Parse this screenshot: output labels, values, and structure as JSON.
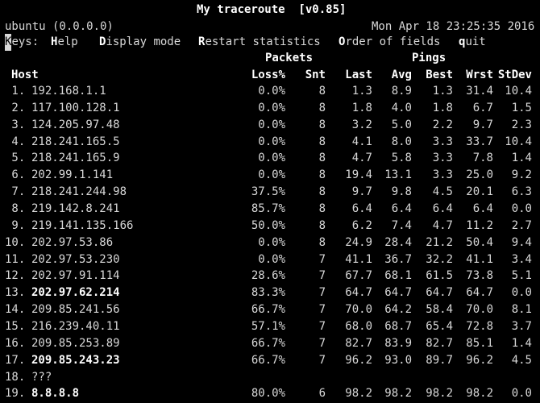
{
  "title": "My traceroute  [v0.85]",
  "hostinfo": "ubuntu (0.0.0.0)",
  "datetime": "Mon Apr 18 23:25:35 2016",
  "keys": {
    "label_first": "K",
    "label_rest": "eys:",
    "items": [
      {
        "key": "H",
        "rest": "elp"
      },
      {
        "key": "D",
        "rest": "isplay mode"
      },
      {
        "key": "R",
        "rest": "estart statistics"
      },
      {
        "key": "O",
        "rest": "rder of fields"
      },
      {
        "key": "q",
        "rest": "uit"
      }
    ]
  },
  "groups": {
    "packets": "Packets",
    "pings": "Pings"
  },
  "columns": {
    "host": "Host",
    "loss": "Loss%",
    "snt": "Snt",
    "last": "Last",
    "avg": "Avg",
    "best": "Best",
    "wrst": "Wrst",
    "stdev": "StDev"
  },
  "rows": [
    {
      "num": " 1.",
      "host": "192.168.1.1",
      "bold": false,
      "loss": "0.0%",
      "snt": "8",
      "last": "1.3",
      "avg": "8.9",
      "best": "1.3",
      "wrst": "31.4",
      "stdev": "10.4"
    },
    {
      "num": " 2.",
      "host": "117.100.128.1",
      "bold": false,
      "loss": "0.0%",
      "snt": "8",
      "last": "1.8",
      "avg": "4.0",
      "best": "1.8",
      "wrst": "6.7",
      "stdev": "1.5"
    },
    {
      "num": " 3.",
      "host": "124.205.97.48",
      "bold": false,
      "loss": "0.0%",
      "snt": "8",
      "last": "3.2",
      "avg": "5.0",
      "best": "2.2",
      "wrst": "9.7",
      "stdev": "2.3"
    },
    {
      "num": " 4.",
      "host": "218.241.165.5",
      "bold": false,
      "loss": "0.0%",
      "snt": "8",
      "last": "4.1",
      "avg": "8.0",
      "best": "3.3",
      "wrst": "33.7",
      "stdev": "10.4"
    },
    {
      "num": " 5.",
      "host": "218.241.165.9",
      "bold": false,
      "loss": "0.0%",
      "snt": "8",
      "last": "4.7",
      "avg": "5.8",
      "best": "3.3",
      "wrst": "7.8",
      "stdev": "1.4"
    },
    {
      "num": " 6.",
      "host": "202.99.1.141",
      "bold": false,
      "loss": "0.0%",
      "snt": "8",
      "last": "19.4",
      "avg": "13.1",
      "best": "3.3",
      "wrst": "25.0",
      "stdev": "9.2"
    },
    {
      "num": " 7.",
      "host": "218.241.244.98",
      "bold": false,
      "loss": "37.5%",
      "snt": "8",
      "last": "9.7",
      "avg": "9.8",
      "best": "4.5",
      "wrst": "20.1",
      "stdev": "6.3"
    },
    {
      "num": " 8.",
      "host": "219.142.8.241",
      "bold": false,
      "loss": "85.7%",
      "snt": "8",
      "last": "6.4",
      "avg": "6.4",
      "best": "6.4",
      "wrst": "6.4",
      "stdev": "0.0"
    },
    {
      "num": " 9.",
      "host": "219.141.135.166",
      "bold": false,
      "loss": "50.0%",
      "snt": "8",
      "last": "6.2",
      "avg": "7.4",
      "best": "4.7",
      "wrst": "11.2",
      "stdev": "2.7"
    },
    {
      "num": "10.",
      "host": "202.97.53.86",
      "bold": false,
      "loss": "0.0%",
      "snt": "8",
      "last": "24.9",
      "avg": "28.4",
      "best": "21.2",
      "wrst": "50.4",
      "stdev": "9.4"
    },
    {
      "num": "11.",
      "host": "202.97.53.230",
      "bold": false,
      "loss": "0.0%",
      "snt": "7",
      "last": "41.1",
      "avg": "36.7",
      "best": "32.2",
      "wrst": "41.1",
      "stdev": "3.4"
    },
    {
      "num": "12.",
      "host": "202.97.91.114",
      "bold": false,
      "loss": "28.6%",
      "snt": "7",
      "last": "67.7",
      "avg": "68.1",
      "best": "61.5",
      "wrst": "73.8",
      "stdev": "5.1"
    },
    {
      "num": "13.",
      "host": "202.97.62.214",
      "bold": true,
      "loss": "83.3%",
      "snt": "7",
      "last": "64.7",
      "avg": "64.7",
      "best": "64.7",
      "wrst": "64.7",
      "stdev": "0.0"
    },
    {
      "num": "14.",
      "host": "209.85.241.56",
      "bold": false,
      "loss": "66.7%",
      "snt": "7",
      "last": "70.0",
      "avg": "64.2",
      "best": "58.4",
      "wrst": "70.0",
      "stdev": "8.1"
    },
    {
      "num": "15.",
      "host": "216.239.40.11",
      "bold": false,
      "loss": "57.1%",
      "snt": "7",
      "last": "68.0",
      "avg": "68.7",
      "best": "65.4",
      "wrst": "72.8",
      "stdev": "3.7"
    },
    {
      "num": "16.",
      "host": "209.85.253.89",
      "bold": false,
      "loss": "66.7%",
      "snt": "7",
      "last": "82.7",
      "avg": "83.9",
      "best": "82.7",
      "wrst": "85.1",
      "stdev": "1.4"
    },
    {
      "num": "17.",
      "host": "209.85.243.23",
      "bold": true,
      "loss": "66.7%",
      "snt": "7",
      "last": "96.2",
      "avg": "93.0",
      "best": "89.7",
      "wrst": "96.2",
      "stdev": "4.5"
    },
    {
      "num": "18.",
      "host": "???",
      "bold": false,
      "loss": "",
      "snt": "",
      "last": "",
      "avg": "",
      "best": "",
      "wrst": "",
      "stdev": ""
    },
    {
      "num": "19.",
      "host": "8.8.8.8",
      "bold": true,
      "loss": "80.0%",
      "snt": "6",
      "last": "98.2",
      "avg": "98.2",
      "best": "98.2",
      "wrst": "98.2",
      "stdev": "0.0"
    }
  ]
}
